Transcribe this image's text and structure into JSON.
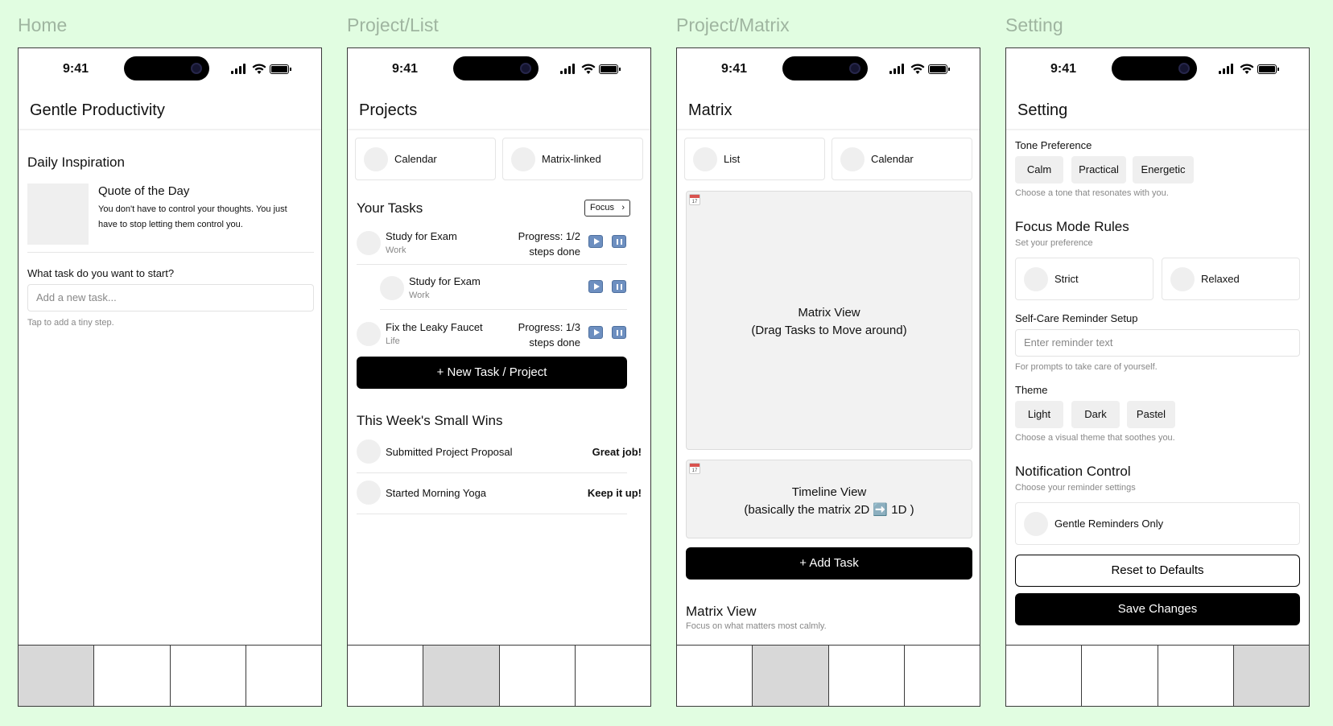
{
  "labels": {
    "home": "Home",
    "list": "Project/List",
    "matrix": "Project/Matrix",
    "setting": "Setting"
  },
  "status_time": "9:41",
  "home": {
    "title": "Gentle Productivity",
    "section_title": "Daily Inspiration",
    "quote_title": "Quote of the Day",
    "quote_text": "You don't have to control your thoughts. You just have to stop letting them control you.",
    "prompt": "What task do you want to start?",
    "input_placeholder": "Add a new task...",
    "hint": "Tap to add a tiny step."
  },
  "list": {
    "title": "Projects",
    "view_buttons": [
      "Calendar",
      "Matrix-linked"
    ],
    "tasks_title": "Your Tasks",
    "focus_label": "Focus",
    "tasks": [
      {
        "name": "Study for Exam",
        "category": "Work",
        "progress_line1": "Progress: 1/2",
        "progress_line2": "steps done"
      },
      {
        "name": "Study for Exam",
        "category": "Work",
        "progress_line1": "",
        "progress_line2": ""
      },
      {
        "name": "Fix the Leaky Faucet",
        "category": "Life",
        "progress_line1": "Progress: 1/3",
        "progress_line2": "steps done"
      }
    ],
    "new_button": "+ New Task / Project",
    "wins_title": "This Week's Small Wins",
    "wins": [
      {
        "name": "Submitted Project Proposal",
        "badge": "Great job!"
      },
      {
        "name": "Started Morning Yoga",
        "badge": "Keep it up!"
      }
    ]
  },
  "matrix": {
    "title": "Matrix",
    "view_buttons": [
      "List",
      "Calendar"
    ],
    "matrix_line1": "Matrix View",
    "matrix_line2": "(Drag Tasks to Move around)",
    "timeline_line1": "Timeline View",
    "timeline_line2": "(basically the matrix 2D ➡️ 1D )",
    "cal_icon_text": "17",
    "add_button": "+ Add Task",
    "footer_title": "Matrix View",
    "footer_sub": "Focus on what matters most calmly."
  },
  "setting": {
    "title": "Setting",
    "tone_title": "Tone Preference",
    "tone_options": [
      "Calm",
      "Practical",
      "Energetic"
    ],
    "tone_hint": "Choose a tone that resonates with you.",
    "focus_title": "Focus Mode Rules",
    "focus_sub": "Set your preference",
    "focus_options": [
      "Strict",
      "Relaxed"
    ],
    "selfcare_title": "Self-Care Reminder Setup",
    "selfcare_placeholder": "Enter reminder text",
    "selfcare_hint": "For prompts to take care of yourself.",
    "theme_title": "Theme",
    "theme_options": [
      "Light",
      "Dark",
      "Pastel"
    ],
    "theme_hint": "Choose a visual theme that soothes you.",
    "notif_title": "Notification Control",
    "notif_sub": "Choose your reminder settings",
    "notif_option": "Gentle Reminders Only",
    "reset_button": "Reset to Defaults",
    "save_button": "Save Changes"
  },
  "tabbar_active": {
    "home": 1,
    "list": 2,
    "matrix": 2,
    "setting": 4
  }
}
